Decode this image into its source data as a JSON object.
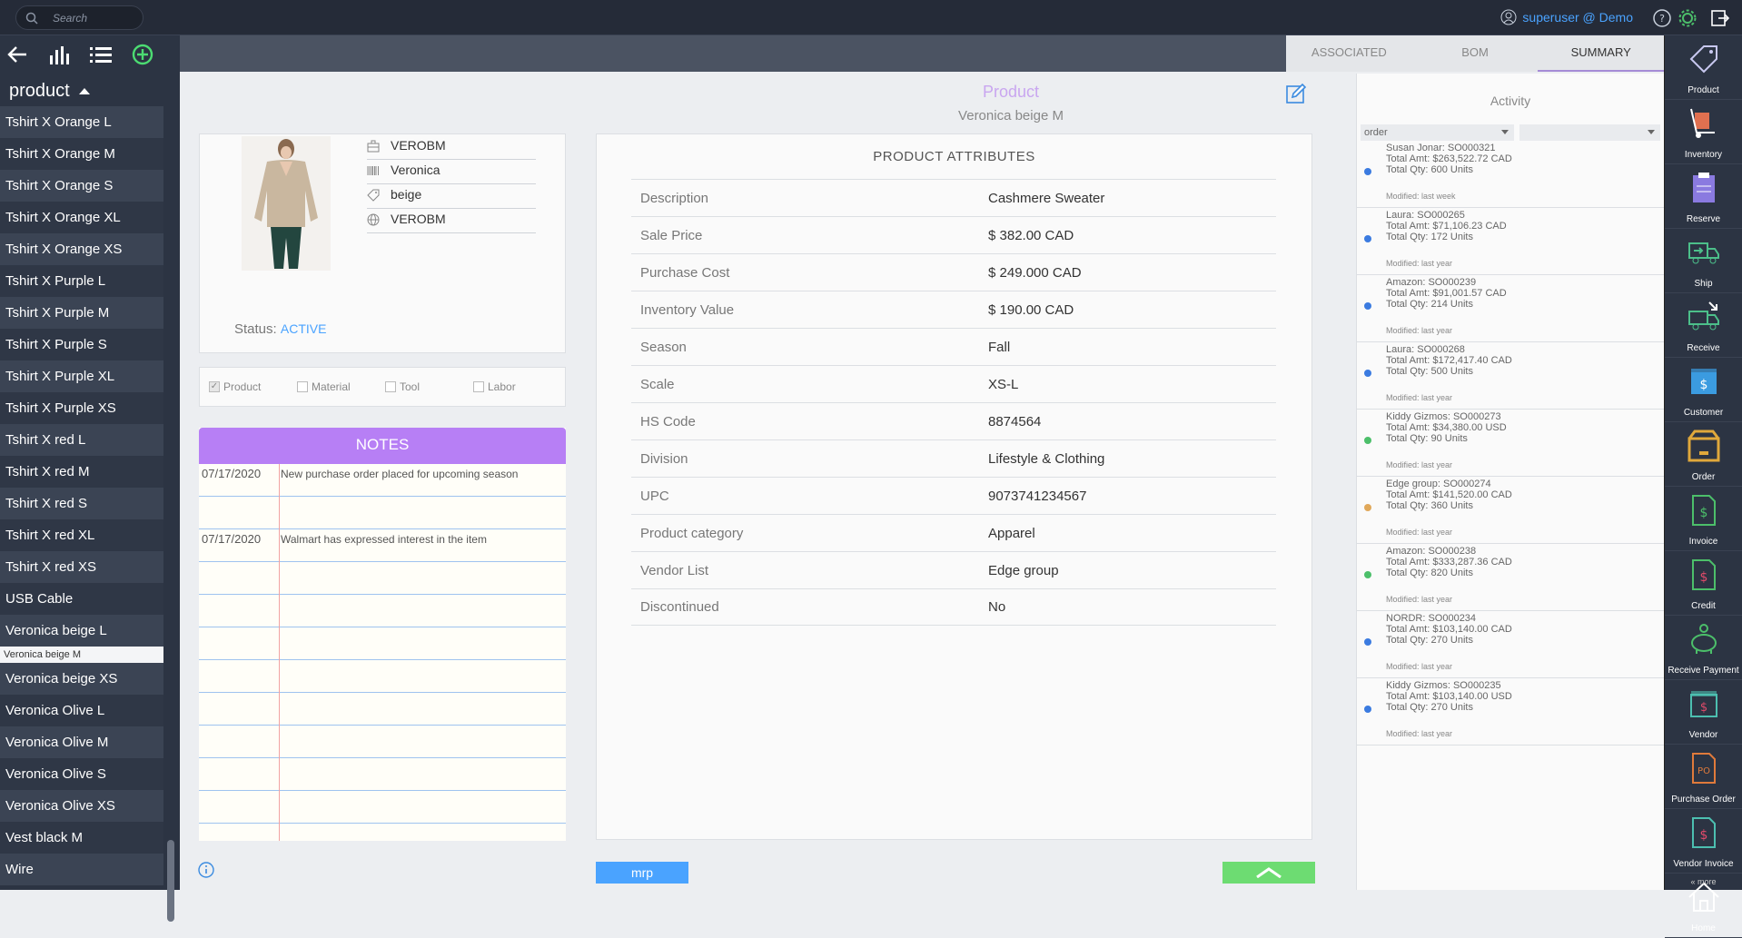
{
  "topbar": {
    "search_placeholder": "Search",
    "user": "superuser @ Demo"
  },
  "left": {
    "section_title": "product",
    "items": [
      "Tshirt X Orange L",
      "Tshirt X Orange M",
      "Tshirt X Orange S",
      "Tshirt X Orange XL",
      "Tshirt X Orange XS",
      "Tshirt X Purple L",
      "Tshirt X Purple M",
      "Tshirt X Purple S",
      "Tshirt X Purple XL",
      "Tshirt X Purple XS",
      "Tshirt X red L",
      "Tshirt X red M",
      "Tshirt X red S",
      "Tshirt X red XL",
      "Tshirt X red XS",
      "USB Cable",
      "Veronica beige L",
      "Veronica beige M",
      "Veronica beige XS",
      "Veronica Olive L",
      "Veronica Olive M",
      "Veronica Olive S",
      "Veronica Olive XS",
      "Vest black M",
      "Wire"
    ],
    "selected": "Veronica beige M"
  },
  "tabs": [
    "ASSOCIATED",
    "BOM",
    "SUMMARY"
  ],
  "active_tab": "SUMMARY",
  "product": {
    "title": "Product",
    "subtitle": "Veronica beige M",
    "sku": "VEROBM",
    "barcode_name": "Veronica",
    "tag": "beige",
    "web_code": "VEROBM",
    "status_label": "Status:",
    "status_value": "ACTIVE"
  },
  "checkboxes": [
    {
      "label": "Product",
      "checked": true
    },
    {
      "label": "Material",
      "checked": false
    },
    {
      "label": "Tool",
      "checked": false
    },
    {
      "label": "Labor",
      "checked": false
    }
  ],
  "notes": {
    "title": "NOTES",
    "rows": [
      {
        "date": "07/17/2020",
        "text": "New purchase order placed for upcoming season"
      },
      {
        "date": "",
        "text": ""
      },
      {
        "date": "07/17/2020",
        "text": "Walmart has expressed interest in the item"
      }
    ]
  },
  "attributes": {
    "title": "PRODUCT ATTRIBUTES",
    "rows": [
      {
        "k": "Description",
        "v": "Cashmere Sweater"
      },
      {
        "k": "Sale Price",
        "v": "$ 382.00 CAD"
      },
      {
        "k": "Purchase Cost",
        "v": "$ 249.000 CAD"
      },
      {
        "k": "Inventory Value",
        "v": "$ 190.00 CAD"
      },
      {
        "k": "Season",
        "v": "Fall"
      },
      {
        "k": "Scale",
        "v": "XS-L"
      },
      {
        "k": "HS Code",
        "v": "8874564"
      },
      {
        "k": "Division",
        "v": "Lifestyle & Clothing"
      },
      {
        "k": "UPC",
        "v": "9073741234567"
      },
      {
        "k": "Product category",
        "v": "Apparel"
      },
      {
        "k": "Vendor List",
        "v": "Edge group"
      },
      {
        "k": "Discontinued",
        "v": "No"
      }
    ]
  },
  "buttons": {
    "mrp": "mrp"
  },
  "activity": {
    "title": "Activity",
    "filter1": "order",
    "filter2": "",
    "items": [
      {
        "l1": "Susan Jonar: SO000321",
        "l2": "Total Amt: $263,522.72 CAD",
        "l3": "Total Qty: 600 Units",
        "m": "Modified: last week",
        "color": "#3b7be0"
      },
      {
        "l1": "Laura: SO000265",
        "l2": "Total Amt: $71,106.23 CAD",
        "l3": "Total Qty: 172 Units",
        "m": "Modified: last year",
        "color": "#3b7be0"
      },
      {
        "l1": "Amazon: SO000239",
        "l2": "Total Amt: $91,001.57 CAD",
        "l3": "Total Qty: 214 Units",
        "m": "Modified: last year",
        "color": "#3b7be0"
      },
      {
        "l1": "Laura: SO000268",
        "l2": "Total Amt: $172,417.40 CAD",
        "l3": "Total Qty: 500 Units",
        "m": "Modified: last year",
        "color": "#3b7be0"
      },
      {
        "l1": "Kiddy Gizmos: SO000273",
        "l2": "Total Amt: $34,380.00 USD",
        "l3": "Total Qty: 90 Units",
        "m": "Modified: last year",
        "color": "#4cbf6a"
      },
      {
        "l1": "Edge group: SO000274",
        "l2": "Total Amt: $141,520.00 CAD",
        "l3": "Total Qty: 360 Units",
        "m": "Modified: last year",
        "color": "#e0a85a"
      },
      {
        "l1": "Amazon: SO000238",
        "l2": "Total Amt: $333,287.36 CAD",
        "l3": "Total Qty: 820 Units",
        "m": "Modified: last year",
        "color": "#4cbf6a"
      },
      {
        "l1": "NORDR: SO000234",
        "l2": "Total Amt: $103,140.00 CAD",
        "l3": "Total Qty: 270 Units",
        "m": "Modified: last year",
        "color": "#3b7be0"
      },
      {
        "l1": "Kiddy Gizmos: SO000235",
        "l2": "Total Amt: $103,140.00 USD",
        "l3": "Total Qty: 270 Units",
        "m": "Modified: last year",
        "color": "#3b7be0"
      }
    ]
  },
  "rightbar": {
    "items": [
      {
        "label": "Product",
        "icon": "product-tag-icon",
        "color": "#c8c8f0"
      },
      {
        "label": "Inventory",
        "icon": "hand-truck-icon",
        "color": "#e07050"
      },
      {
        "label": "Reserve",
        "icon": "clipboard-icon",
        "color": "#8a7ae0"
      },
      {
        "label": "Ship",
        "icon": "truck-ship-icon",
        "color": "#4cbf8a"
      },
      {
        "label": "Receive",
        "icon": "truck-receive-icon",
        "color": "#4cbf8a"
      },
      {
        "label": "Customer",
        "icon": "customer-box-icon",
        "color": "#3b9be0"
      },
      {
        "label": "Order",
        "icon": "order-box-icon",
        "color": "#e0a83b"
      },
      {
        "label": "Invoice",
        "icon": "invoice-icon",
        "color": "#4cbf6a"
      },
      {
        "label": "Credit",
        "icon": "credit-icon",
        "color": "#4cbf6a"
      },
      {
        "label": "Receive Payment",
        "icon": "piggy-bank-icon",
        "color": "#4cbf6a"
      },
      {
        "label": "Vendor",
        "icon": "vendor-box-icon",
        "color": "#4cbfb0"
      },
      {
        "label": "Purchase Order",
        "icon": "purchase-order-icon",
        "color": "#e07a3b"
      },
      {
        "label": "Vendor Invoice",
        "icon": "vendor-invoice-icon",
        "color": "#4cbfb0"
      },
      {
        "label": "Home",
        "icon": "home-icon",
        "color": "#ffffff"
      }
    ],
    "more": "« more"
  },
  "colors": {
    "accent": "#b77ff5",
    "link": "#4aa3ff",
    "dark": "#2c3443"
  }
}
